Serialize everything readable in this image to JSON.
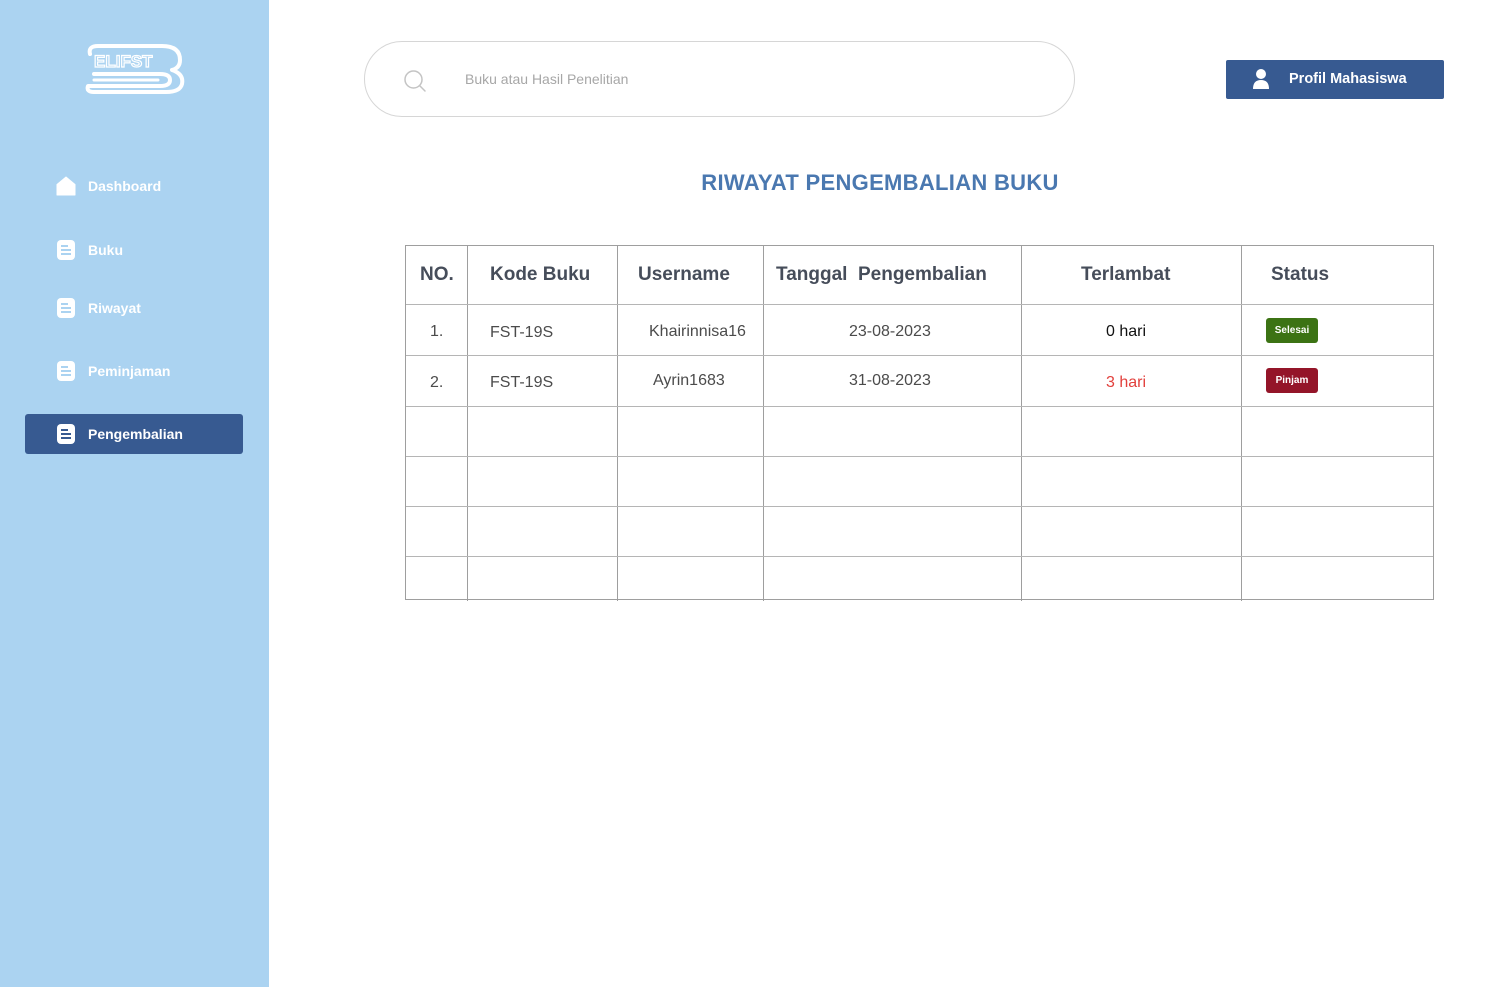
{
  "app": {
    "logo_text": "ELIFST",
    "colors": {
      "sidebar": "#abd3f1",
      "accent": "#375a91",
      "title": "#4a78b0",
      "late": "#e2403c",
      "done": "#3c7314",
      "borrow": "#941529"
    }
  },
  "sidebar": {
    "items": [
      {
        "label": "Dashboard",
        "icon": "home-icon"
      },
      {
        "label": "Buku",
        "icon": "document-icon"
      },
      {
        "label": "Riwayat",
        "icon": "document-icon"
      },
      {
        "label": "Peminjaman",
        "icon": "document-icon"
      },
      {
        "label": "Pengembalian",
        "icon": "document-icon",
        "active": true
      }
    ]
  },
  "search": {
    "placeholder": "Buku atau Hasil Penelitian",
    "value": ""
  },
  "profile": {
    "label": "Profil Mahasiswa",
    "icon": "user-icon"
  },
  "page": {
    "title": "RIWAYAT PENGEMBALIAN BUKU"
  },
  "table": {
    "headers": [
      "NO.",
      "Kode Buku",
      "Username",
      "Tanggal  Pengembalian",
      "Terlambat",
      "Status"
    ],
    "rows": [
      {
        "no": "1.",
        "kode": "FST-19S",
        "username": "Khairinnisa16",
        "tanggal": "23-08-2023",
        "terlambat": "0 hari",
        "status": "Selesai"
      },
      {
        "no": "2.",
        "kode": "FST-19S",
        "username": "Ayrin1683",
        "tanggal": "31-08-2023",
        "terlambat": "3 hari",
        "status": "Pinjam"
      }
    ],
    "empty_rows": 4
  }
}
